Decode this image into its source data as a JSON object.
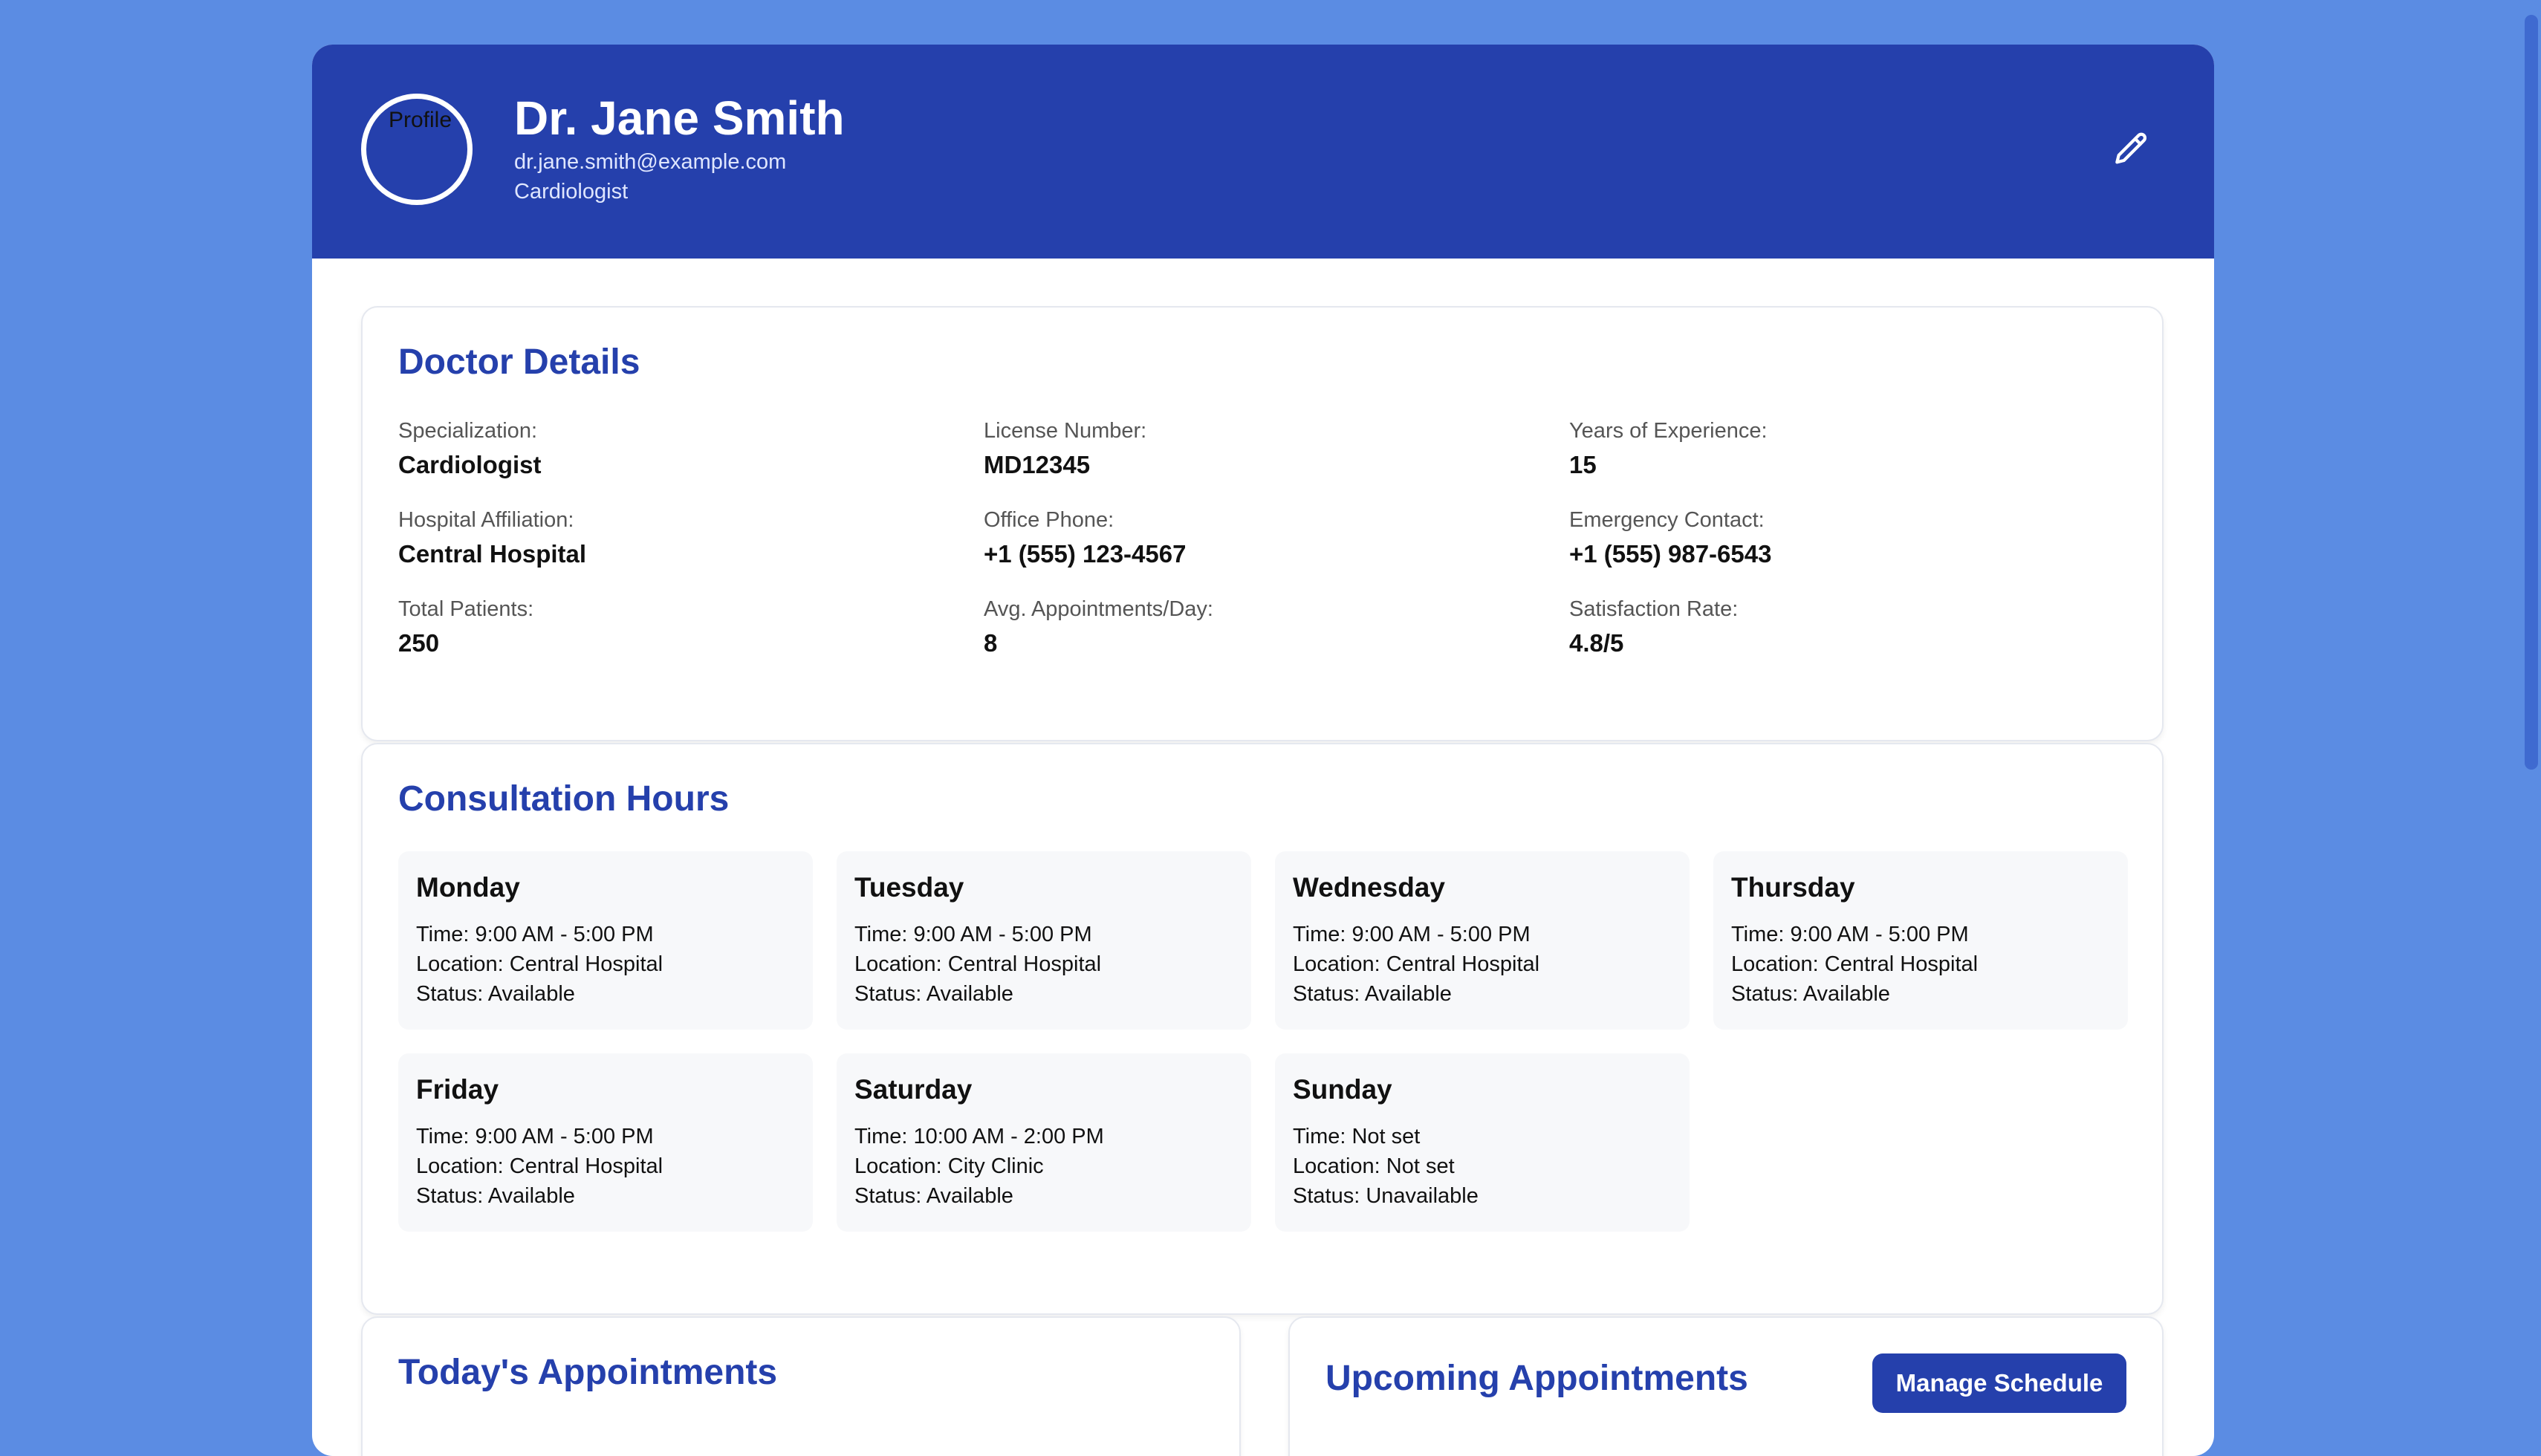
{
  "header": {
    "avatar_alt": "Profile",
    "name": "Dr. Jane Smith",
    "email": "dr.jane.smith@example.com",
    "title": "Cardiologist",
    "edit_icon": "pencil-icon"
  },
  "details": {
    "title": "Doctor Details",
    "items": [
      {
        "label": "Specialization:",
        "value": "Cardiologist"
      },
      {
        "label": "License Number:",
        "value": "MD12345"
      },
      {
        "label": "Years of Experience:",
        "value": "15"
      },
      {
        "label": "Hospital Affiliation:",
        "value": "Central Hospital"
      },
      {
        "label": "Office Phone:",
        "value": "+1 (555) 123-4567"
      },
      {
        "label": "Emergency Contact:",
        "value": "+1 (555) 987-6543"
      },
      {
        "label": "Total Patients:",
        "value": "250"
      },
      {
        "label": "Avg. Appointments/Day:",
        "value": "8"
      },
      {
        "label": "Satisfaction Rate:",
        "value": "4.8/5"
      }
    ]
  },
  "hours": {
    "title": "Consultation Hours",
    "days": [
      {
        "name": "Monday",
        "time": "Time: 9:00 AM - 5:00 PM",
        "location": "Location: Central Hospital",
        "status": "Status: Available"
      },
      {
        "name": "Tuesday",
        "time": "Time: 9:00 AM - 5:00 PM",
        "location": "Location: Central Hospital",
        "status": "Status: Available"
      },
      {
        "name": "Wednesday",
        "time": "Time: 9:00 AM - 5:00 PM",
        "location": "Location: Central Hospital",
        "status": "Status: Available"
      },
      {
        "name": "Thursday",
        "time": "Time: 9:00 AM - 5:00 PM",
        "location": "Location: Central Hospital",
        "status": "Status: Available"
      },
      {
        "name": "Friday",
        "time": "Time: 9:00 AM - 5:00 PM",
        "location": "Location: Central Hospital",
        "status": "Status: Available"
      },
      {
        "name": "Saturday",
        "time": "Time: 10:00 AM - 2:00 PM",
        "location": "Location: City Clinic",
        "status": "Status: Available"
      },
      {
        "name": "Sunday",
        "time": "Time: Not set",
        "location": "Location: Not set",
        "status": "Status: Unavailable"
      }
    ]
  },
  "appointments": {
    "today_title": "Today's Appointments",
    "upcoming_title": "Upcoming Appointments",
    "manage_label": "Manage Schedule"
  },
  "colors": {
    "background": "#5b8ce3",
    "header": "#2540ac",
    "accent": "#2540ac"
  }
}
